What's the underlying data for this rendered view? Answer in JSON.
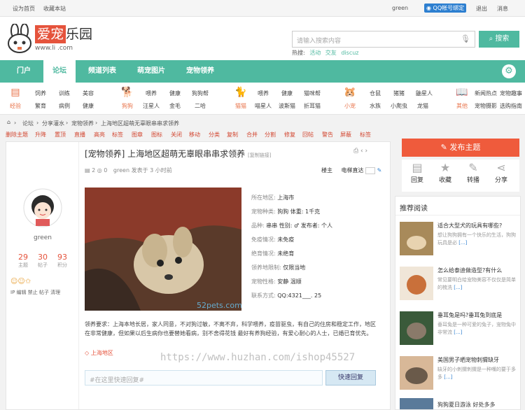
{
  "topbar": {
    "set_home": "设为首页",
    "bookmark": "收藏本站",
    "user": "green",
    "qq_bind": "QQ帐号绑定",
    "logout": "退出",
    "messages": "消息"
  },
  "header": {
    "logo_cn": "爱宠",
    "logo_cn2": "乐园",
    "logo_url": "www.li        .com",
    "search_placeholder": "请输入搜索内容",
    "search_btn": "搜索",
    "hot_label": "热搜:",
    "hot1": "活动",
    "hot2": "交友",
    "hot3": "discuz"
  },
  "nav": {
    "items": [
      "门户",
      "论坛",
      "频道列表",
      "萌宠图片",
      "宠物领养"
    ],
    "active": "论坛"
  },
  "cats": [
    {
      "icon": "经验",
      "label": "经验",
      "links": [
        "饲养",
        "训练",
        "美容",
        "繁育",
        "病例",
        "健康"
      ]
    },
    {
      "icon": "狗狗",
      "label": "狗狗",
      "links": [
        "喂养",
        "健康",
        "狗狗帮",
        "汪星人",
        "金毛",
        "二哈"
      ]
    },
    {
      "icon": "猫猫",
      "label": "猫猫",
      "links": [
        "喂养",
        "健康",
        "猫咪帮",
        "喵星人",
        "波斯猫",
        "折耳猫"
      ]
    },
    {
      "icon": "小宠",
      "label": "小宠",
      "links": [
        "仓鼠",
        "猪猪",
        "鼬星人",
        "水族",
        "小爬虫",
        "龙猫"
      ]
    },
    {
      "icon": "其他",
      "label": "其他",
      "links": [
        "新闻热点",
        "宠物趣事",
        "宠物摄影",
        "宠物活动",
        "宠物选择",
        "选购指南"
      ]
    }
  ],
  "crumb": [
    "论坛",
    "分享灌水",
    "宠物领养",
    "上海地区超萌无辜眼串串求领养"
  ],
  "tools": [
    "删除主题",
    "升降",
    "置顶",
    "直播",
    "高亮",
    "标签",
    "图章",
    "图标",
    "关闭",
    "移动",
    "分类",
    "复制",
    "合并",
    "分割",
    "修复",
    "回帖",
    "警告",
    "屏蔽",
    "标签"
  ],
  "post": {
    "title": "[宠物领养] 上海地区超萌无辜眼串串求领养",
    "copy_link": "[复制链接]",
    "replies": "2",
    "views": "0",
    "meta": "green 发表于 3 小时前",
    "floor": "楼主",
    "elevator": "电梯直达",
    "author": "green",
    "stats": [
      {
        "v": "29",
        "l": "主题"
      },
      {
        "v": "30",
        "l": "帖子"
      },
      {
        "v": "93",
        "l": "积分"
      }
    ],
    "author_links": "IP 编辑 禁止 帖子 清理",
    "info": [
      {
        "k": "所在地区:",
        "v": "上海市"
      },
      {
        "k": "宠物种类:",
        "v": "狗狗  体重: 1千克"
      },
      {
        "k": "品种:",
        "v": "串串  性别: ♂  发布者: 个人"
      },
      {
        "k": "免疫情况:",
        "v": "未免疫"
      },
      {
        "k": "绝育情况:",
        "v": "未绝育"
      },
      {
        "k": "领养地限制:",
        "v": "仅限当地"
      },
      {
        "k": "宠物性格:",
        "v": "安静 温顺"
      },
      {
        "k": "联系方式:",
        "v": "QQ:4321___. 25"
      }
    ],
    "watermark": "52pets.com",
    "body": "领养要求：上海本地长居，家人同意，不对狗过敏，不离不弃，科学喂养，疫苗驱虫，有自己的住房和稳定工作，地区在非常健康，但如果以后生病你也要替她看病，别不舍得花钱 最好有养狗经验，有爱心耐心的人士，已婚已育优先。",
    "location_tag": "上海地区",
    "reply_placeholder": "#在这里快速回复#",
    "reply_btn": "快速回复"
  },
  "side": {
    "post_btn": "发布主题",
    "actions": [
      "回复",
      "收藏",
      "转播",
      "分享"
    ],
    "rec_title": "推荐阅读",
    "items": [
      {
        "title": "适合大型犬的玩具有哪些?",
        "desc": "想让狗狗拥有一个快乐的生活，狗狗玩具是必",
        "more": "[...]"
      },
      {
        "title": "怎么给泰迪做造型?有什么",
        "desc": "常见要明白给宠物美容不仅仅是简单的梳洗",
        "more": "[...]"
      },
      {
        "title": "垂耳兔是吗?垂耳兔到底是",
        "desc": "垂耳兔是一种可爱的兔子，宠物兔中非常流",
        "more": "[...]"
      },
      {
        "title": "美国男子晒宠物刺猬缺牙",
        "desc": "缺牙的小刺猬刺猬是一种嘴的要于多多",
        "more": "[...]"
      },
      {
        "title": "狗狗夏日游泳 好处多多",
        "desc": "",
        "more": ""
      }
    ]
  },
  "watermark_url": "https://www.huzhan.com/ishop45527"
}
